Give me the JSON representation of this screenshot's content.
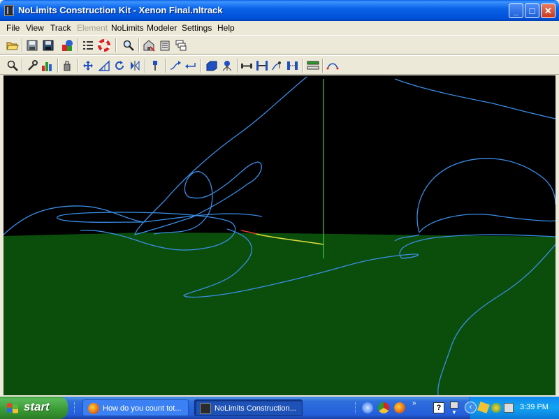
{
  "window": {
    "title": "NoLimits Construction Kit - Xenon Final.nltrack",
    "controls": {
      "minimize": "_",
      "maximize": "□",
      "close": "✕"
    }
  },
  "menu": [
    {
      "label": "File",
      "enabled": true
    },
    {
      "label": "View",
      "enabled": true
    },
    {
      "label": "Track",
      "enabled": true
    },
    {
      "label": "Element",
      "enabled": false
    },
    {
      "label": "NoLimits",
      "enabled": true
    },
    {
      "label": "Modeler",
      "enabled": true
    },
    {
      "label": "Settings",
      "enabled": true
    },
    {
      "label": "Help",
      "enabled": true
    }
  ],
  "toolbar1": [
    "open-folder-icon",
    "save-icon",
    "save-as-icon",
    "shapes-icon",
    "element-list-icon",
    "lifebuoy-icon",
    "zoom-icon",
    "house-icon",
    "stack-icon",
    "layers-icon"
  ],
  "toolbar2": [
    "magnify-icon",
    "wrench-icon",
    "bar-chart-icon",
    "paint-icon",
    "move-icon",
    "ramp-icon",
    "rotate-icon",
    "flip-icon",
    "torch-icon",
    "curve-arrow-icon",
    "return-arrow-icon",
    "block-icon",
    "tree-icon",
    "dumbbell-icon",
    "support-icon",
    "person-icon",
    "split-icon",
    "grid-icon",
    "arc-icon"
  ],
  "viewport": {
    "sky_color": "#000000",
    "ground_color": "#0b4e0b",
    "track_color": "#3a8ee8"
  },
  "taskbar": {
    "start_label": "start",
    "tasks": [
      {
        "label": "How do you count tot...",
        "active": false
      },
      {
        "label": "NoLimits Construction...",
        "active": true
      }
    ],
    "clock": "3:39 PM"
  }
}
